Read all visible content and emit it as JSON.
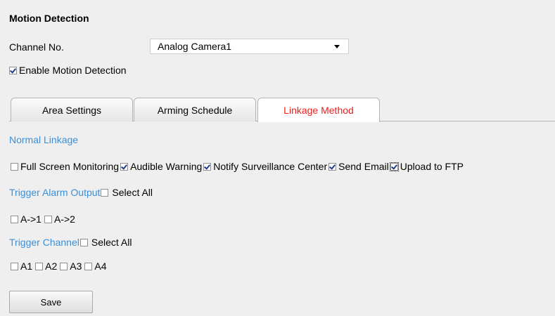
{
  "page": {
    "title": "Motion Detection",
    "channel_label": "Channel No.",
    "channel_value": "Analog Camera1",
    "enable_label": "Enable Motion Detection",
    "enable_checked": true
  },
  "tabs": [
    {
      "label": "Area Settings",
      "active": false
    },
    {
      "label": "Arming Schedule",
      "active": false
    },
    {
      "label": "Linkage Method",
      "active": true
    }
  ],
  "normal_linkage": {
    "heading": "Normal Linkage",
    "options": [
      {
        "label": "Full Screen Monitoring",
        "checked": false
      },
      {
        "label": "Audible Warning",
        "checked": true
      },
      {
        "label": "Notify Surveillance Center",
        "checked": true
      },
      {
        "label": "Send Email",
        "checked": true
      },
      {
        "label": "Upload to FTP",
        "checked": true
      }
    ]
  },
  "trigger_alarm_output": {
    "heading": "Trigger Alarm Output",
    "select_all_label": "Select All",
    "options": [
      {
        "label": "A->1",
        "checked": false
      },
      {
        "label": "A->2",
        "checked": false
      }
    ]
  },
  "trigger_channel": {
    "heading": "Trigger Channel",
    "select_all_label": "Select All",
    "options": [
      {
        "label": "A1",
        "checked": false
      },
      {
        "label": "A2",
        "checked": false
      },
      {
        "label": "A3",
        "checked": false
      },
      {
        "label": "A4",
        "checked": false
      }
    ]
  },
  "save_label": "Save",
  "colors": {
    "background": "#efefef",
    "section_heading": "#3b8fd6",
    "active_tab_text": "#ee1c1c"
  }
}
